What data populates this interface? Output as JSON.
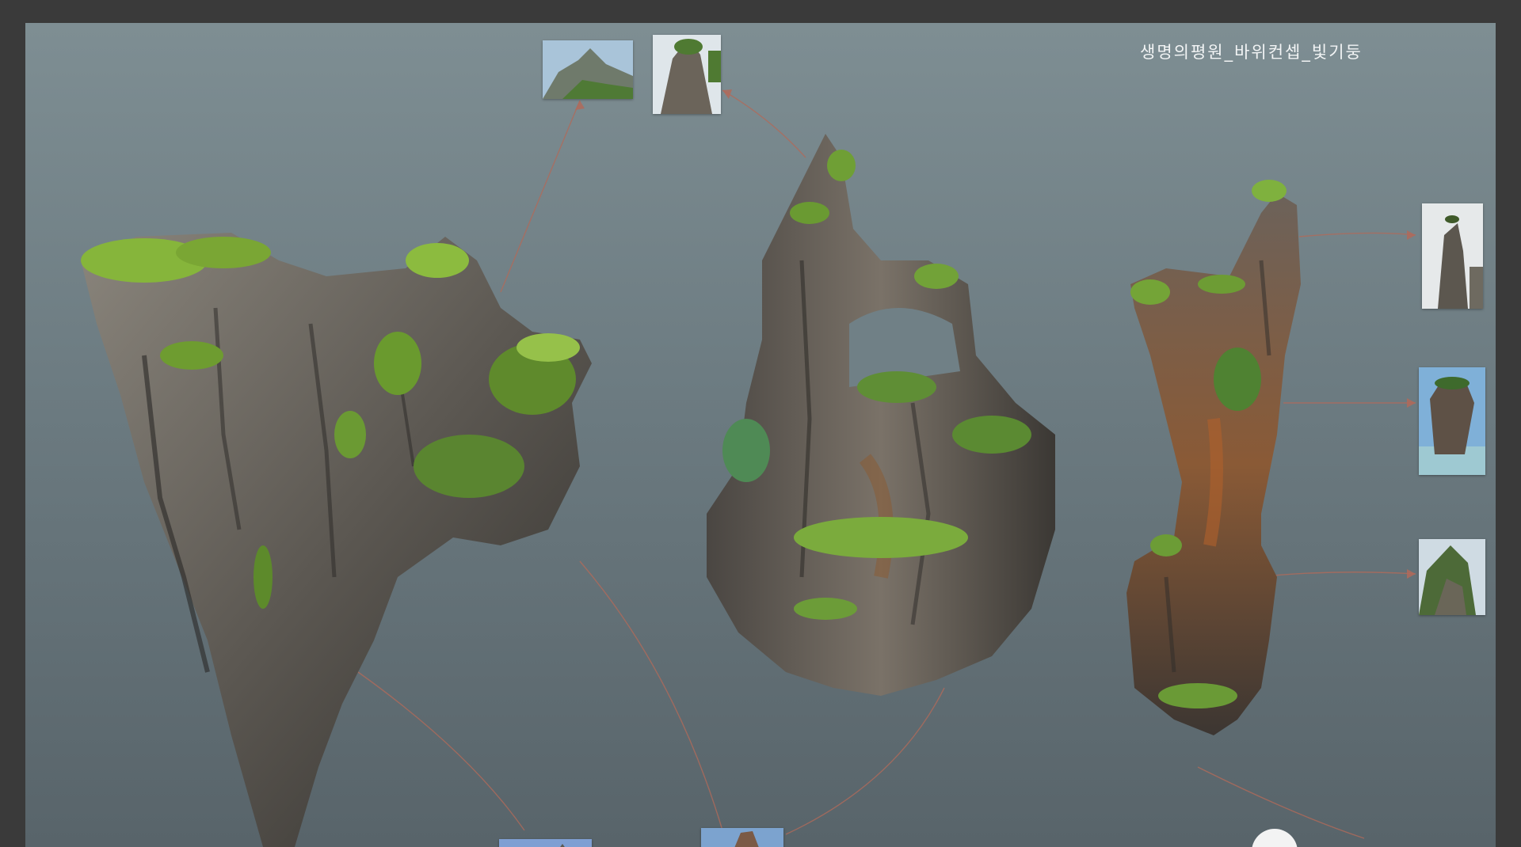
{
  "canvas": {
    "title": "생명의평원_바위컨셉_빛기둥"
  },
  "colors": {
    "background_frame": "#3a3a3a",
    "board_top": "#7e8e93",
    "board_bottom": "#58646a",
    "arrow": "#b06a5a",
    "moss": "#7fae3c",
    "rock": "#6b6660"
  },
  "references": [
    {
      "name": "mountain-ridge-photo"
    },
    {
      "name": "karst-peak-photo"
    },
    {
      "name": "pine-top-pillar-photo"
    },
    {
      "name": "sea-stack-photo"
    },
    {
      "name": "green-peak-photo"
    },
    {
      "name": "bottom-left-photo"
    },
    {
      "name": "bottom-center-photo"
    }
  ]
}
